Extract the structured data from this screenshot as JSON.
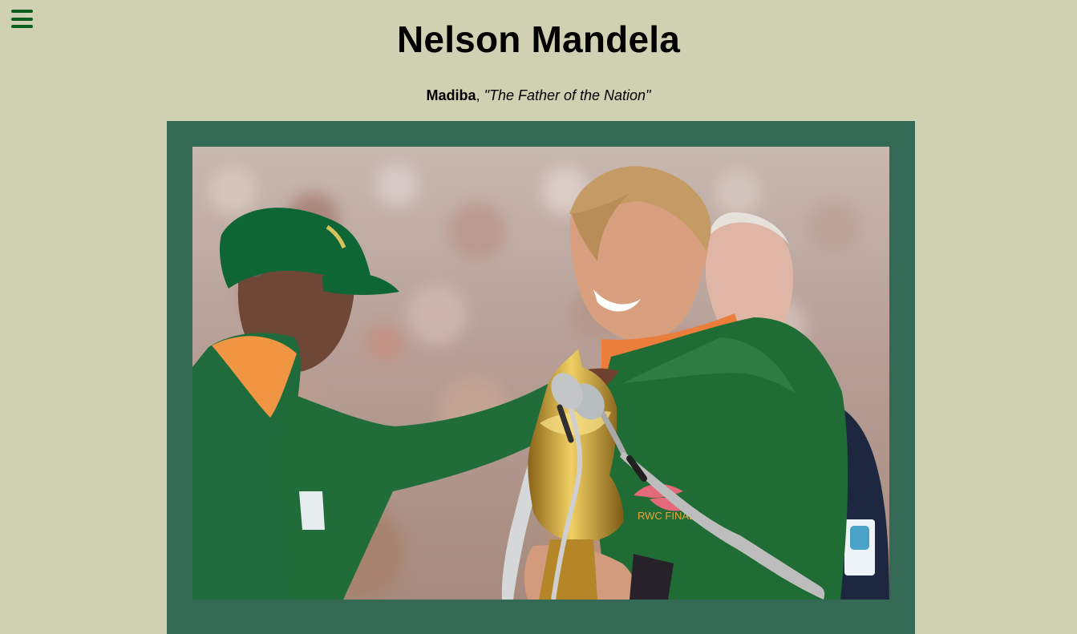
{
  "header": {
    "menu_icon": "hamburger-menu-icon",
    "title": "Nelson Mandela",
    "subtitle_name": "Madiba",
    "subtitle_separator": ", ",
    "subtitle_quote": "\"The Father of the Nation\""
  },
  "colors": {
    "background": "#d0d0b3",
    "frame": "#336955",
    "menu_icon": "#0b5e1d"
  }
}
